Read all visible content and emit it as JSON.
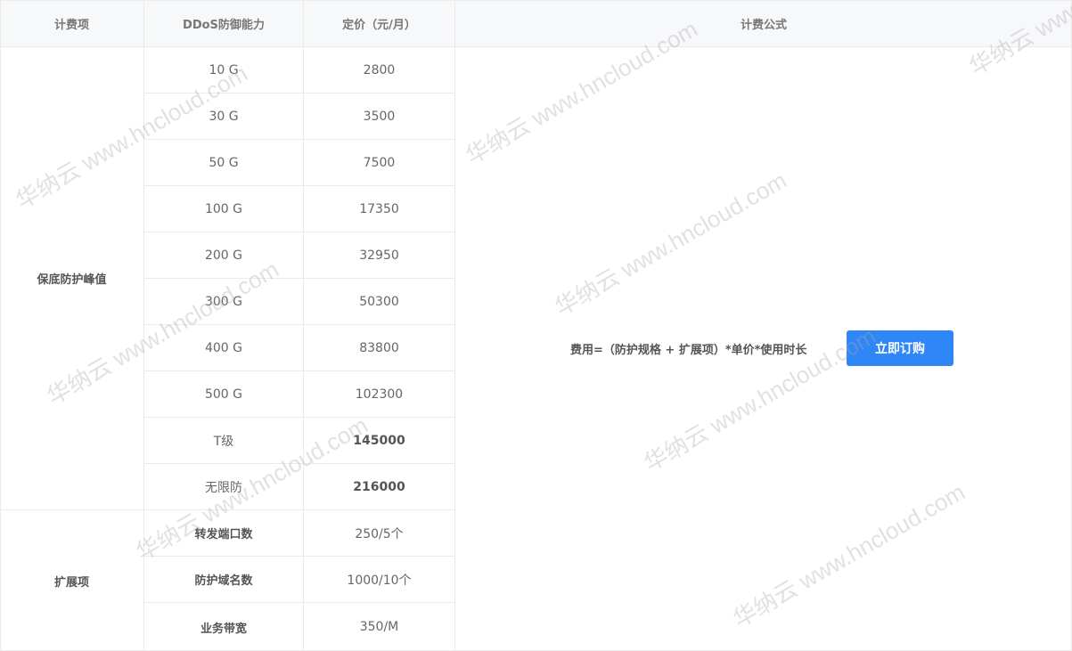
{
  "headers": {
    "item": "计费项",
    "capacity": "DDoS防御能力",
    "price": "定价（元/月）",
    "formula": "计费公式"
  },
  "groups": {
    "base": "保底防护峰值",
    "ext": "扩展项"
  },
  "rows": [
    {
      "capacity": "10 G",
      "price": "2800"
    },
    {
      "capacity": "30 G",
      "price": "3500"
    },
    {
      "capacity": "50 G",
      "price": "7500"
    },
    {
      "capacity": "100 G",
      "price": "17350"
    },
    {
      "capacity": "200 G",
      "price": "32950"
    },
    {
      "capacity": "300 G",
      "price": "50300"
    },
    {
      "capacity": "400 G",
      "price": "83800"
    },
    {
      "capacity": "500 G",
      "price": "102300"
    },
    {
      "capacity": "T级",
      "price": "145000"
    },
    {
      "capacity": "无限防",
      "price": "216000"
    }
  ],
  "ext_rows": [
    {
      "capacity": "转发端口数",
      "price": "250/5个"
    },
    {
      "capacity": "防护域名数",
      "price": "1000/10个"
    },
    {
      "capacity": "业务带宽",
      "price": "350/M"
    }
  ],
  "formula_text": "费用=（防护规格 + 扩展项）*单价*使用时长",
  "order_button": "立即订购",
  "watermark": "华纳云 www.hncloud.com",
  "accent_color": "#2f86f6"
}
